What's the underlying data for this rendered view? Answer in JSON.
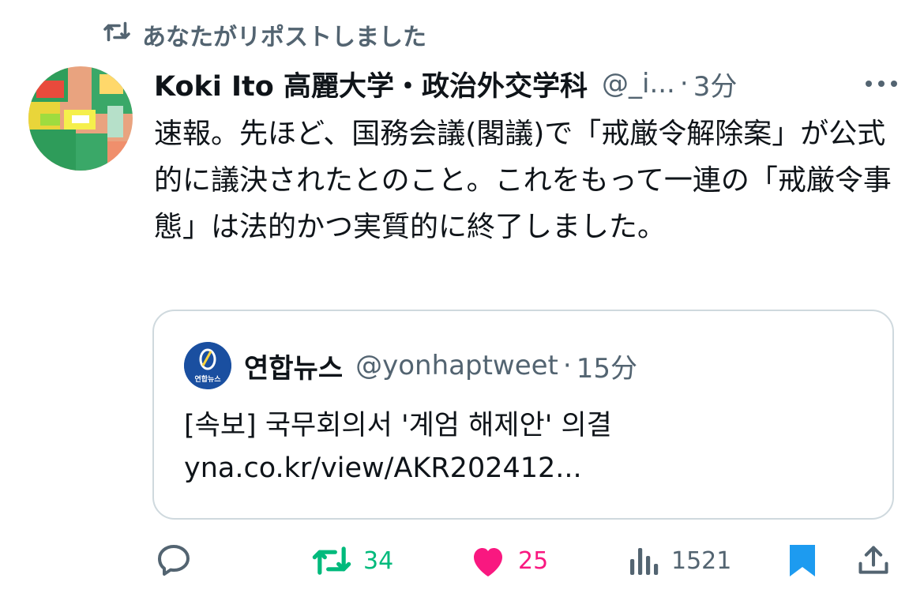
{
  "repost_banner": {
    "icon": "repost-icon",
    "text": "あなたがリポストしました"
  },
  "tweet": {
    "author": {
      "display_name": "Koki Ito 高麗大学・政治外交学科",
      "handle": "@_i...",
      "separator": "·",
      "time": "3分",
      "avatar_icon": "avatar"
    },
    "more_icon": "more-icon",
    "text": "速報。先ほど、国務会議(閣議)で「戒厳令解除案」が公式的に議決されたとのこと。これをもって一連の「戒厳令事態」は法的かつ実質的に終了しました。"
  },
  "quote": {
    "author": {
      "display_name": "연합뉴스",
      "handle": "@yonhaptweet",
      "separator": "·",
      "time": "15分",
      "avatar_text": "연합뉴스"
    },
    "text_line1": "[속보] 국무회의서 '계엄 해제안' 의결",
    "text_line2": "yna.co.kr/view/AKR202412..."
  },
  "actions": {
    "reply": {
      "icon": "reply-icon"
    },
    "repost": {
      "icon": "repost-icon",
      "count": "34",
      "color": "#00ba7c"
    },
    "like": {
      "icon": "heart-icon",
      "count": "25",
      "color": "#f91880"
    },
    "views": {
      "icon": "views-icon",
      "count": "1521",
      "color": "#536471"
    },
    "bookmark": {
      "icon": "bookmark-icon",
      "color": "#1d9bf0"
    },
    "share": {
      "icon": "share-icon"
    }
  }
}
